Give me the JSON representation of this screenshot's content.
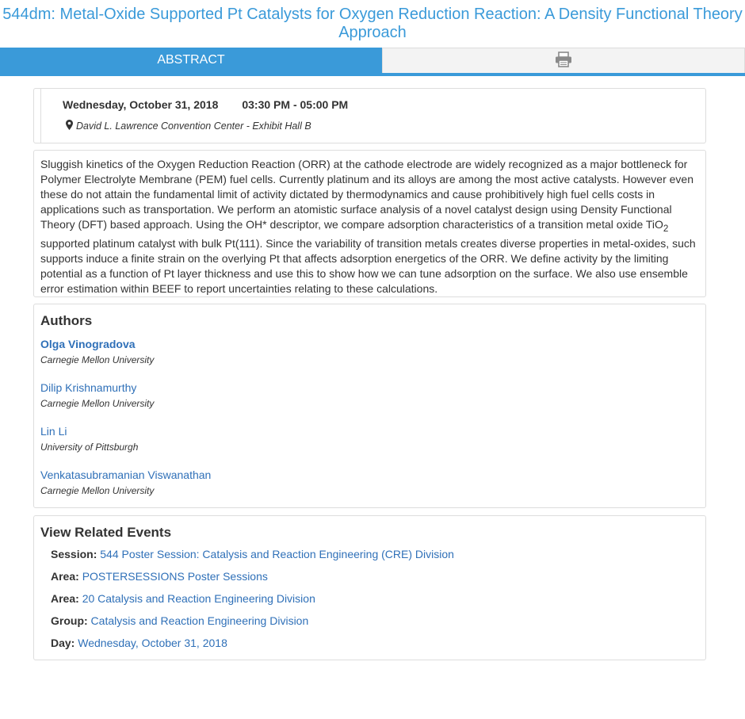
{
  "page": {
    "title": "544dm: Metal-Oxide Supported Pt Catalysts for Oxygen Reduction Reaction: A Density Functional Theory Approach"
  },
  "tabs": {
    "abstract_label": "ABSTRACT",
    "print_icon": "print-icon"
  },
  "session": {
    "date": "Wednesday, October 31, 2018",
    "time": "03:30 PM - 05:00 PM",
    "location": "David L. Lawrence Convention Center - Exhibit Hall B",
    "location_icon": "map-marker-icon"
  },
  "abstract": {
    "text_part1": "Sluggish kinetics of the Oxygen Reduction Reaction (ORR) at the cathode electrode are widely recognized as a major bottleneck for Polymer Electrolyte Membrane (PEM) fuel cells. Currently platinum and its alloys are among the most active catalysts. However even these do not attain the fundamental limit of activity dictated by thermodynamics and cause prohibitively high fuel cells costs in applications such as transportation. We perform an atomistic surface analysis of a novel catalyst design using Density Functional Theory (DFT) based approach. Using the OH* descriptor, we compare adsorption characteristics of a transition metal oxide TiO",
    "subscript": "2",
    "text_part2": " supported platinum catalyst with bulk Pt(111). Since the variability of transition metals creates diverse properties in metal-oxides, such supports induce a finite strain on the overlying Pt that affects adsorption energetics of the ORR. We define activity by the limiting potential as a function of Pt layer thickness and use this to show how we can tune adsorption on the surface. We also use ensemble error estimation within BEEF to report uncertainties relating to these calculations."
  },
  "authors": {
    "heading": "Authors",
    "list": [
      {
        "name": "Olga Vinogradova",
        "affiliation": "Carnegie Mellon University"
      },
      {
        "name": "Dilip Krishnamurthy",
        "affiliation": "Carnegie Mellon University"
      },
      {
        "name": "Lin Li",
        "affiliation": "University of Pittsburgh"
      },
      {
        "name": "Venkatasubramanian Viswanathan",
        "affiliation": "Carnegie Mellon University"
      }
    ]
  },
  "related": {
    "heading": "View Related Events",
    "items": [
      {
        "key": "Session:",
        "value": "544 Poster Session: Catalysis and Reaction Engineering (CRE) Division"
      },
      {
        "key": "Area:",
        "value": "POSTERSESSIONS Poster Sessions"
      },
      {
        "key": "Area:",
        "value": "20 Catalysis and Reaction Engineering Division"
      },
      {
        "key": "Group:",
        "value": "Catalysis and Reaction Engineering Division"
      },
      {
        "key": "Day:",
        "value": "Wednesday, October 31, 2018"
      }
    ]
  },
  "colors": {
    "accent": "#3a9ad9",
    "link": "#2f70b8",
    "text": "#333333",
    "border": "#dddddd"
  }
}
